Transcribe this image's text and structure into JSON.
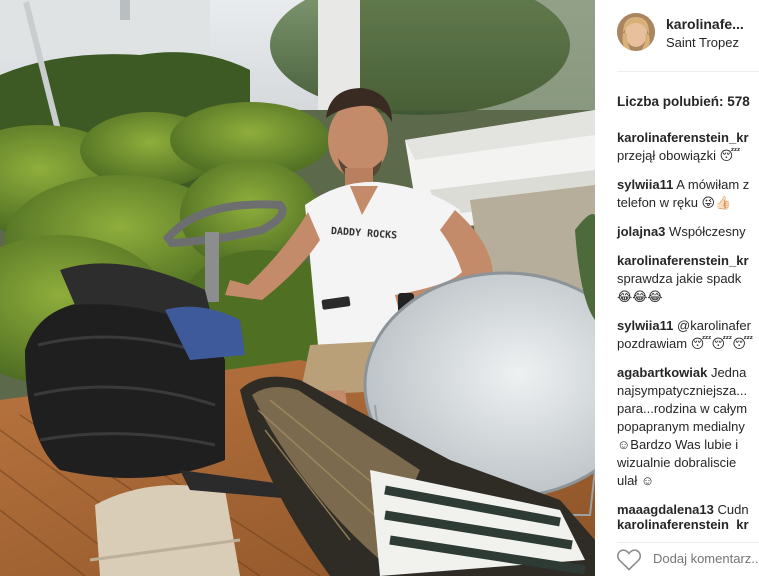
{
  "post": {
    "username": "karolinafe...",
    "location": "Saint Tropez",
    "likes_label": "Liczba polubień: 578"
  },
  "comments": [
    {
      "user": "karolinaferenstein_kr",
      "lines": [
        "przejął obowiązki 😴"
      ]
    },
    {
      "user": "sylwiia11",
      "text": "A mówiłam z",
      "lines": [
        "telefon w ręku 😜👍🏻"
      ]
    },
    {
      "user": "jolajna3",
      "text": "Współczesny",
      "lines": []
    },
    {
      "user": "karolinaferenstein_kr",
      "lines": [
        "sprawdza jakie spadk",
        "😂😂😂"
      ]
    },
    {
      "user": "sylwiia11",
      "text": "@karolinafer",
      "lines": [
        "pozdrawiam 😴😴😴"
      ]
    },
    {
      "user": "agabartkowiak",
      "text": "Jedna",
      "lines": [
        "najsympatyczniejsza...",
        "para...rodzina w całym",
        "popapranym medialny",
        "☺Bardzo Was lubie i",
        "wizualnie dobraliscie",
        "ulał ☺"
      ]
    },
    {
      "user": "maaagdalena13",
      "text": "Cudn",
      "lines": []
    }
  ],
  "partial_comment_user": "karolinaferenstein_kr",
  "photo": {
    "tshirt_text": "DADDY ROCKS"
  },
  "footer": {
    "add_comment_placeholder": "Dodaj komentarz..."
  },
  "colors": {
    "text": "#262626",
    "muted": "#999999",
    "divider": "#efefef"
  },
  "icons": {
    "like": "heart-outline-icon"
  }
}
